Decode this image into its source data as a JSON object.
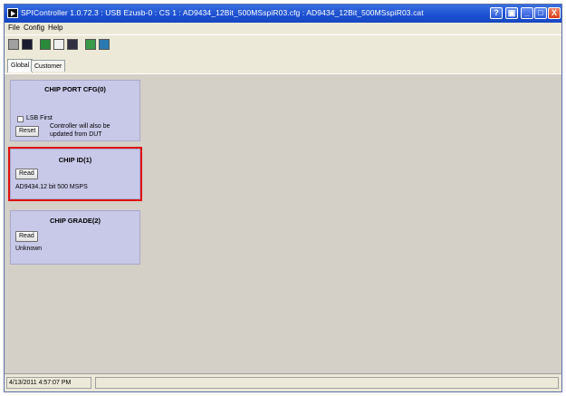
{
  "window": {
    "title": "SPIController 1.0.72.3 : USB Ezusb-0 : CS 1 : AD9434_12Bit_500MSspiR03.cfg : AD9434_12Bit_500MSspiR03.cat",
    "buttons": [
      "help",
      "restore-small",
      "minimize",
      "maximize",
      "close"
    ]
  },
  "menu": {
    "file": "File",
    "config": "Config",
    "help": "Help"
  },
  "toolbar": {
    "icons": [
      "stop-icon",
      "save-icon",
      "new-icon",
      "open-icon",
      "chip-icon",
      "graph-icon",
      "export-icon"
    ]
  },
  "tabs": {
    "global": "Global",
    "customer": "Customer"
  },
  "panels": {
    "chip_port_cfg": {
      "title": "CHIP PORT CFG(0)",
      "lsb_first_label": "LSB First",
      "reset_label": "Reset",
      "note_line1": "Controller will also be",
      "note_line2": "updated from DUT"
    },
    "chip_id": {
      "title": "CHIP ID(1)",
      "read_label": "Read",
      "value": "AD9434.12 bit 500 MSPS"
    },
    "chip_grade": {
      "title": "CHIP GRADE(2)",
      "read_label": "Read",
      "value": "Unknown"
    }
  },
  "status": {
    "timestamp": "4/13/2011 4:57:07 PM"
  },
  "colors": {
    "panel_bg": "#c8c8e8",
    "highlight": "#e01010",
    "titlebar": "#1a4fd0"
  }
}
